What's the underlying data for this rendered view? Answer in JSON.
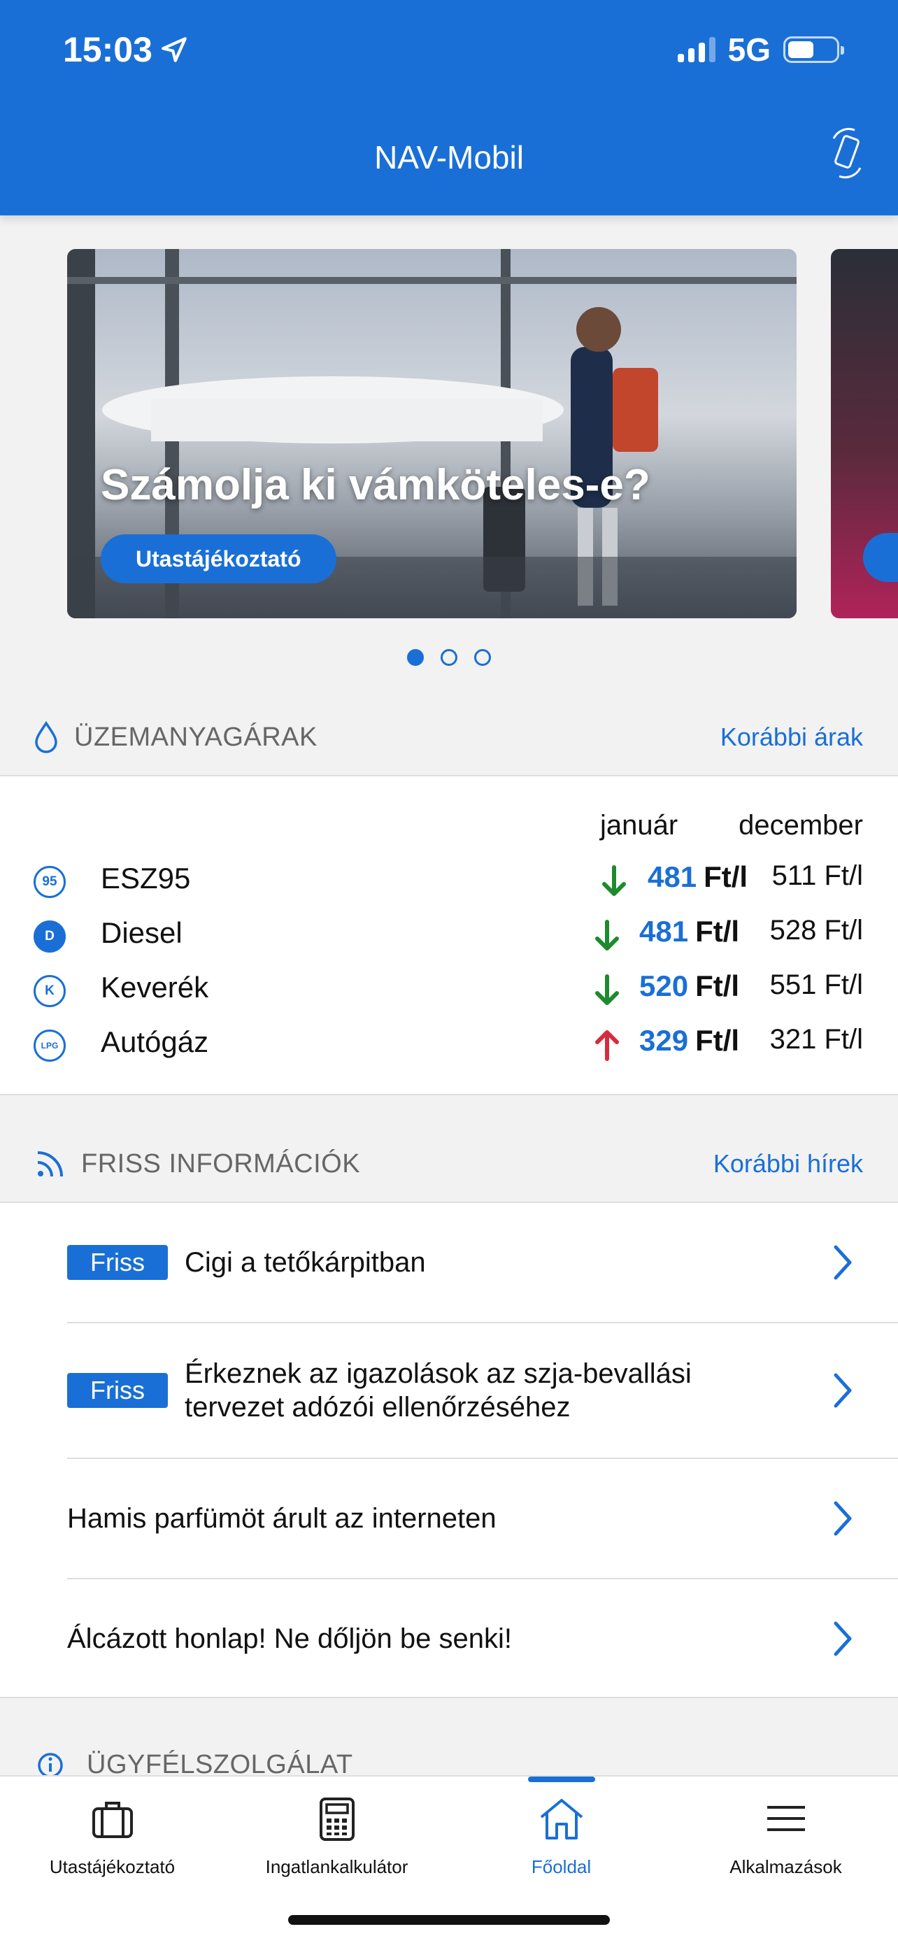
{
  "status_bar": {
    "time": "15:03",
    "network": "5G",
    "battery_level": 0.55
  },
  "header": {
    "title": "NAV-Mobil",
    "action_icon": "phone-rotate-icon"
  },
  "carousel": {
    "slide_title": "Számolja ki vámköteles-e?",
    "slide_button": "Utastájékoztató",
    "slide_count": 3,
    "active_index": 0
  },
  "fuel": {
    "section_title": "ÜZEMANYAGÁRAK",
    "section_link": "Korábbi árak",
    "col_current": "január",
    "col_previous": "december",
    "rows": [
      {
        "badge": "95",
        "name": "ESZ95",
        "trend": "down",
        "current": "481",
        "unit": "Ft/l",
        "previous": "511 Ft/l"
      },
      {
        "badge": "D",
        "name": "Diesel",
        "trend": "down",
        "current": "481",
        "unit": "Ft/l",
        "previous": "528 Ft/l"
      },
      {
        "badge": "K",
        "name": "Keverék",
        "trend": "down",
        "current": "520",
        "unit": "Ft/l",
        "previous": "551 Ft/l"
      },
      {
        "badge": "LPG",
        "name": "Autógáz",
        "trend": "up",
        "current": "329",
        "unit": "Ft/l",
        "previous": "321 Ft/l"
      }
    ],
    "colors": {
      "down": "#1e8a2e",
      "up": "#d62b3f"
    }
  },
  "news": {
    "section_title": "FRISS INFORMÁCIÓK",
    "section_link": "Korábbi hírek",
    "badge_label": "Friss",
    "items": [
      {
        "fresh": true,
        "text": "Cigi a tetőkárpitban"
      },
      {
        "fresh": true,
        "text": "Érkeznek az igazolások az szja-bevallási tervezet adózói ellenőrzéséhez"
      },
      {
        "fresh": false,
        "text": "Hamis parfümöt árult az interneten"
      },
      {
        "fresh": false,
        "text": "Álcázott honlap! Ne dőljön be senki!"
      }
    ]
  },
  "support": {
    "section_title": "ÜGYFÉLSZOLGÁLAT"
  },
  "tabbar": {
    "tabs": [
      {
        "label": "Utastájékoztató",
        "icon": "suitcase-icon",
        "active": false
      },
      {
        "label": "Ingatlankalkulátor",
        "icon": "calculator-icon",
        "active": false
      },
      {
        "label": "Főoldal",
        "icon": "home-icon",
        "active": true
      },
      {
        "label": "Alkalmazások",
        "icon": "menu-icon",
        "active": false
      }
    ]
  },
  "colors": {
    "brand": "#1a6fd6",
    "background": "#f2f2f2"
  }
}
